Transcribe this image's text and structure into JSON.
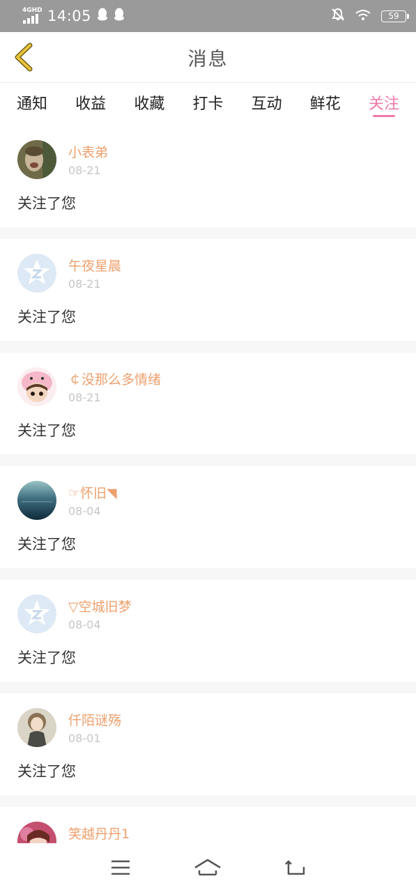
{
  "status_bar": {
    "network": "4GHD",
    "time": "14:05",
    "battery": "59",
    "icons": [
      "signal-icon",
      "qq-icon",
      "qq-icon",
      "mute-bell-icon",
      "wifi-icon",
      "battery-icon"
    ]
  },
  "header": {
    "title": "消息"
  },
  "tabs": [
    {
      "label": "通知"
    },
    {
      "label": "收益"
    },
    {
      "label": "收藏"
    },
    {
      "label": "打卡"
    },
    {
      "label": "互动"
    },
    {
      "label": "鲜花"
    },
    {
      "label": "关注",
      "active": true
    }
  ],
  "notifications": [
    {
      "name": "小表弟",
      "date": "08-21",
      "message": "关注了您"
    },
    {
      "name": "午夜星晨",
      "date": "08-21",
      "message": "关注了您"
    },
    {
      "name": "￠没那么多情绪",
      "date": "08-21",
      "message": "关注了您"
    },
    {
      "name": "☞怀旧◥",
      "date": "08-04",
      "message": "关注了您"
    },
    {
      "name": "▽空城旧梦",
      "date": "08-04",
      "message": "关注了您"
    },
    {
      "name": "仟陌谜殇",
      "date": "08-01",
      "message": "关注了您"
    },
    {
      "name": "笑越丹丹1",
      "date": "",
      "message": ""
    }
  ],
  "colors": {
    "accent": "#ee79a9",
    "username": "#eda06d",
    "back_arrow": "#e8c43d"
  },
  "bottom_nav": [
    "menu-icon",
    "home-icon",
    "back-icon"
  ]
}
